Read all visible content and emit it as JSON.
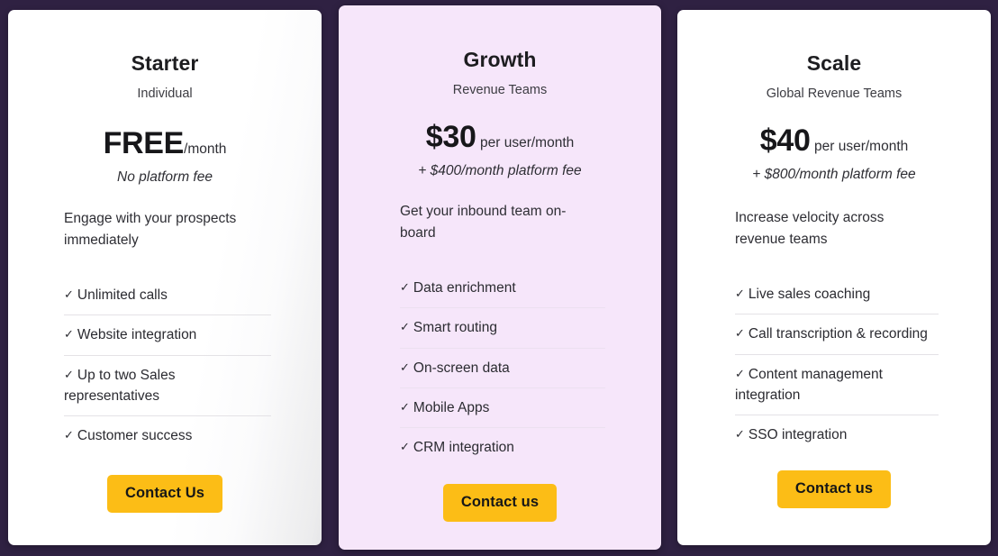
{
  "page": {
    "background_color": "#2f2142",
    "accent_color": "#fcbd16"
  },
  "plans": [
    {
      "id": "starter",
      "name": "Starter",
      "audience": "Individual",
      "price_amount": "FREE",
      "price_unit": "/month",
      "price_note": "No platform fee",
      "tagline": "Engage with your prospects immediately",
      "card_color": "#ffffff",
      "check_icon": "✓",
      "features": [
        "Unlimited calls",
        "Website integration",
        "Up to two Sales representatives",
        "Customer success"
      ],
      "cta_label": "Contact Us"
    },
    {
      "id": "growth",
      "name": "Growth",
      "audience": "Revenue Teams",
      "price_amount": "$30",
      "price_unit": "per user/month",
      "price_note": "+ $400/month platform fee",
      "tagline": "Get your inbound team on-board",
      "card_color": "#f6e6fa",
      "check_icon": "✓",
      "features": [
        "Data enrichment",
        "Smart routing",
        "On-screen data",
        "Mobile Apps",
        "CRM integration"
      ],
      "cta_label": "Contact us"
    },
    {
      "id": "scale",
      "name": "Scale",
      "audience": "Global Revenue Teams",
      "price_amount": "$40",
      "price_unit": "per user/month",
      "price_note": "+ $800/month platform fee",
      "tagline": "Increase velocity across revenue teams",
      "card_color": "#ffffff",
      "check_icon": "✓",
      "features": [
        "Live sales coaching",
        "Call transcription & recording",
        "Content management integration",
        "SSO integration"
      ],
      "cta_label": "Contact us"
    }
  ]
}
